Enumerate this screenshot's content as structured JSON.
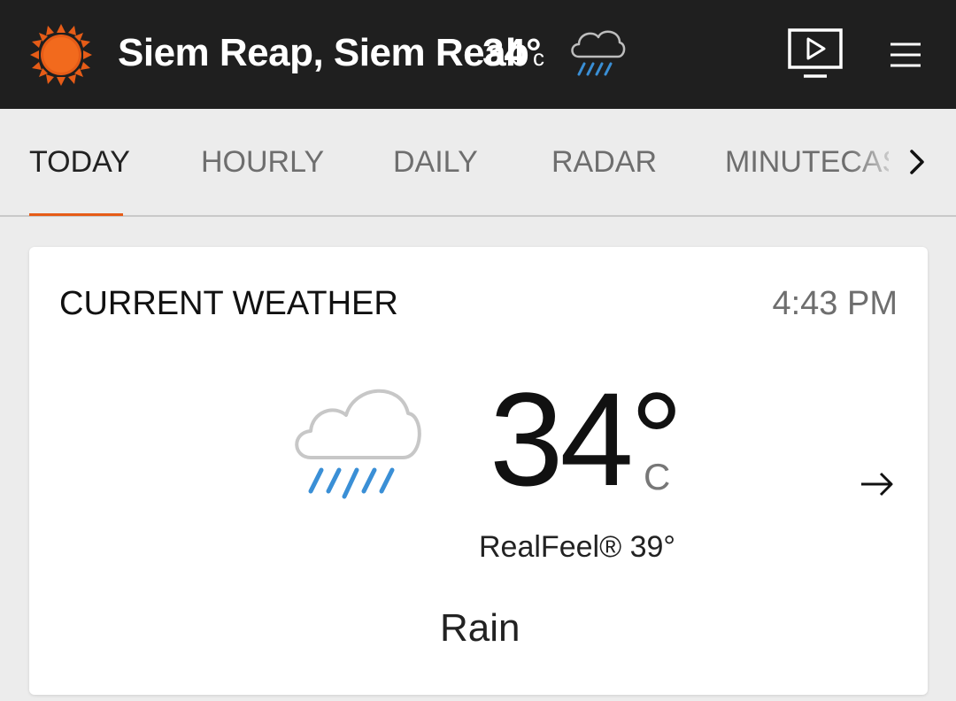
{
  "colors": {
    "header_bg": "#1f1f1f",
    "accent": "#e65c17",
    "rain_drops": "#3a8fd6",
    "background": "#ececec",
    "card": "#ffffff"
  },
  "header": {
    "logo_icon": "sun-icon",
    "location": "Siem Reap, Siem Reab",
    "temperature": "34°",
    "unit": "c",
    "condition_icon": "rain-cloud-icon",
    "video_icon": "video-play-icon",
    "menu_icon": "hamburger-menu-icon"
  },
  "tabs": {
    "items": [
      {
        "label": "TODAY",
        "active": true
      },
      {
        "label": "HOURLY",
        "active": false
      },
      {
        "label": "DAILY",
        "active": false
      },
      {
        "label": "RADAR",
        "active": false
      },
      {
        "label": "MINUTECAST",
        "active": false
      }
    ],
    "next_icon": "chevron-right-icon"
  },
  "current": {
    "title": "CURRENT WEATHER",
    "time": "4:43 PM",
    "condition_icon": "rain-cloud-icon",
    "temperature": "34°",
    "unit": "C",
    "realfeel": "RealFeel® 39°",
    "condition": "Rain",
    "details_icon": "arrow-right-icon"
  }
}
